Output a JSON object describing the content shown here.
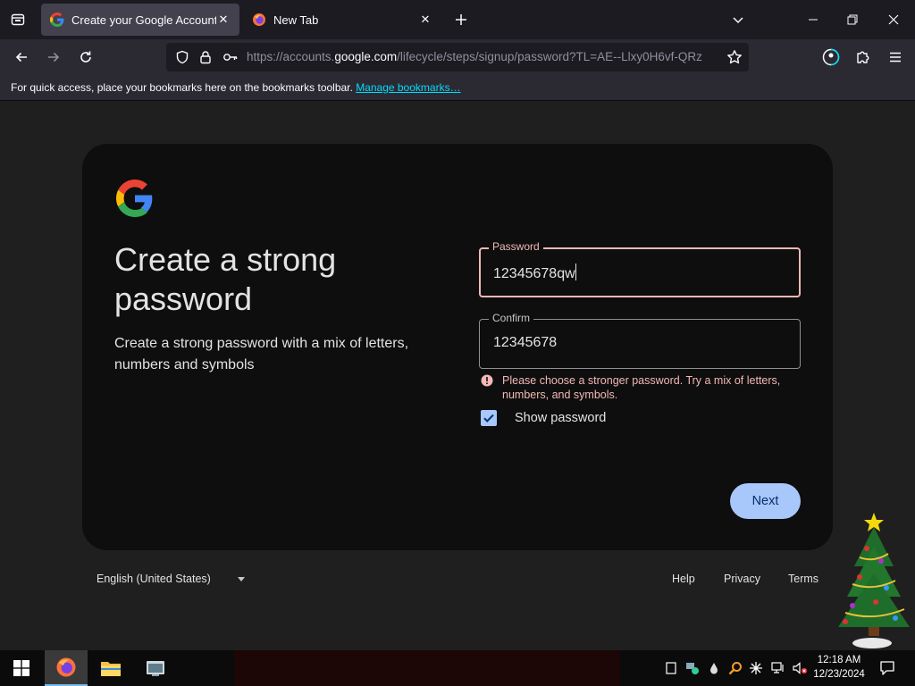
{
  "browser": {
    "tabs": [
      {
        "title": "Create your Google Account",
        "active": true
      },
      {
        "title": "New Tab",
        "active": false
      }
    ],
    "url": {
      "prefix": "https://accounts.",
      "host": "google.com",
      "path": "/lifecycle/steps/signup/password?TL=AE--Llxy0H6vf-QRz"
    },
    "bookmarks_bar": {
      "message": "For quick access, place your bookmarks here on the bookmarks toolbar. ",
      "link": "Manage bookmarks…"
    }
  },
  "signup": {
    "title": "Create a strong password",
    "subtitle": "Create a strong password with a mix of letters, numbers and symbols",
    "password": {
      "label": "Password",
      "value": "12345678qw"
    },
    "confirm": {
      "label": "Confirm",
      "value": "12345678"
    },
    "error": "Please choose a stronger password. Try a mix of letters, numbers, and symbols.",
    "show_password": {
      "label": "Show password",
      "checked": true
    },
    "next_label": "Next"
  },
  "footer": {
    "language": "English (United States)",
    "links": {
      "help": "Help",
      "privacy": "Privacy",
      "terms": "Terms"
    }
  },
  "taskbar": {
    "time": "12:18 AM",
    "date": "12/23/2024"
  },
  "colors": {
    "accent": "#a8c7fa",
    "error": "#f2b8b5",
    "card": "#0e0e0e",
    "page": "#1f1f1f"
  }
}
